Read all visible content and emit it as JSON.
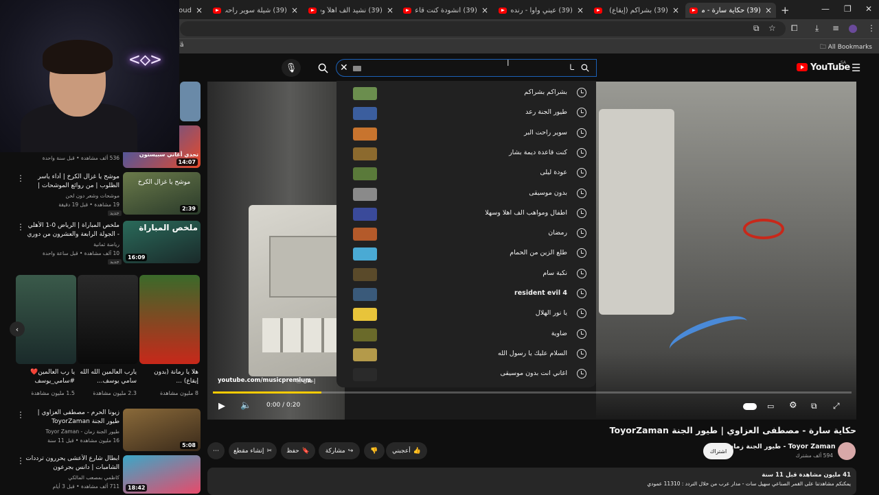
{
  "browser": {
    "tabs": [
      {
        "title": "(39) حكاية سارة - مصطفى",
        "active": true
      },
      {
        "title": "(39) بشراكم (إيقاع) | طيور",
        "active": false
      },
      {
        "title": "(39) عيني واوا - رنده صلاح",
        "active": false
      },
      {
        "title": "(39) أنشودة كنت قاعدة طيـ",
        "active": false
      },
      {
        "title": "(39) نشيد الف اهلاً وسهلاً ال",
        "active": false
      },
      {
        "title": "(39) شيلة سوير راحت البر",
        "active": false
      },
      {
        "title": "loud",
        "active": false
      }
    ],
    "new_tab": "+",
    "bookmarks_label": "All Bookmarks",
    "address_partial": "ä"
  },
  "youtube": {
    "logo_text": "YouTube",
    "region": "SA",
    "search_value": "ـا",
    "suggestions": [
      {
        "text": "بشراكم بشراكم",
        "thumb": "#6b8e4e"
      },
      {
        "text": "طيور الجنة رعد",
        "thumb": "#3b5e9e"
      },
      {
        "text": "سوير راحت البر",
        "thumb": "#c8742e"
      },
      {
        "text": "كنت قاعدة ديمة بشار",
        "thumb": "#8c6a2e"
      },
      {
        "text": "عودة ليلى",
        "thumb": "#5a7a3a"
      },
      {
        "text": "بدون موسيقى",
        "thumb": "#8a8a8a"
      },
      {
        "text": "اطفال ومواهب الف اهلا وسهلا",
        "thumb": "#3a4a9a"
      },
      {
        "text": "رمضان",
        "thumb": "#b45a2a"
      },
      {
        "text": "طلع الزين من الحمام",
        "thumb": "#4aaad4"
      },
      {
        "text": "نكبة سام",
        "thumb": "#5a4a2a"
      },
      {
        "text": "resident evil 4",
        "thumb": "#3a5a7a"
      },
      {
        "text": "يا نور الهلال",
        "thumb": "#e8c43a"
      },
      {
        "text": "ضاوية",
        "thumb": "#6a6a2a"
      },
      {
        "text": "السلام عليك يا رسول الله",
        "thumb": "#b49a4a"
      },
      {
        "text": "اغاني انت بدون موسيقى",
        "thumb": "#2a2a2a"
      }
    ],
    "player": {
      "ad_url": "youtube.com/musicpremium",
      "ad_label": "إعلان",
      "time": "0:00 / 0:20",
      "progress": 0.17
    },
    "video": {
      "title": "حكاية سارة - مصطفى العزاوي | طيور الجنة ToyorZaman",
      "channel": "طيور الجنة زمان - Toyor Zaman",
      "subscribers": "594 ألف مشترك",
      "subscribe_label": "اشتراك",
      "like_label": "أعجبني",
      "share_label": "مشاركة",
      "save_label": "حفظ",
      "clip_label": "إنشاء مقطع",
      "views": "41 مليون مشاهدة  قبل 11 سنة",
      "desc_line": "يمكنكم مشاهدتنا على القمر الصناعي سهيل سات - مدار عرب من خلال التردد : 11310 عمودي"
    }
  },
  "sidebar": {
    "items": [
      {
        "meta": "536 ألف مشاهدة • قبل سنة واحدة",
        "duration": "14:07",
        "title": "تحدي أغاني سبيستون",
        "color": "#3a6ac8"
      },
      {
        "title": "موشح يا غزال الكرخ | أداء ياسر الظلوب | من روائع الموشحات | بلحن الف",
        "channel": "موشحات وشعر دون لحن",
        "meta": "19 مشاهدة • قبل 19 دقيقة",
        "badge": "جديد",
        "duration": "2:39",
        "thumb_text": "موشح يا غزال الكرخ",
        "color": "#4a5a3a"
      },
      {
        "title": "ملخص المباراة | الرياض 0-1 الأهلي - الجولة الرابعة والعشرون من دوري روشن",
        "channel": "رياضة ثمانية",
        "meta": "10 آلف مشاهدة • قبل ساعة واحدة",
        "badge": "جديد",
        "duration": "16:09",
        "thumb_text": "ملخص المباراة",
        "color": "#2a4a3a"
      },
      {
        "title": "زيونا الحرم - مصطفى العزاوي | طيور الجنة ToyorZaman",
        "channel": "طيور الجنة زمان - Toyor Zaman",
        "meta": "16 مليون مشاهدة • قبل 11 سنة",
        "duration": "5:08",
        "color": "#8a6a3a"
      },
      {
        "title": "ابطال شارع الأعشى يحررون ترددات الشامبات | دانس بجرعون",
        "channel": "كاظمي بمصعب المالكي",
        "meta": "711 ألف مشاهدة • قبل 3 أيام",
        "duration": "18:42",
        "color": "#3aa8c8"
      }
    ],
    "shorts": [
      {
        "title": "يا رب العالمين❤️ #سامي_يوسف",
        "views": "1.5 مليون مشاهدة"
      },
      {
        "title": "يارب العالمين الله الله سامي يوسف...",
        "views": "2.3 مليون مشاهدة"
      },
      {
        "title": "هلا يا رمانة (بدون إيقاع) ...",
        "views": "8 مليون مشاهدة"
      }
    ]
  }
}
